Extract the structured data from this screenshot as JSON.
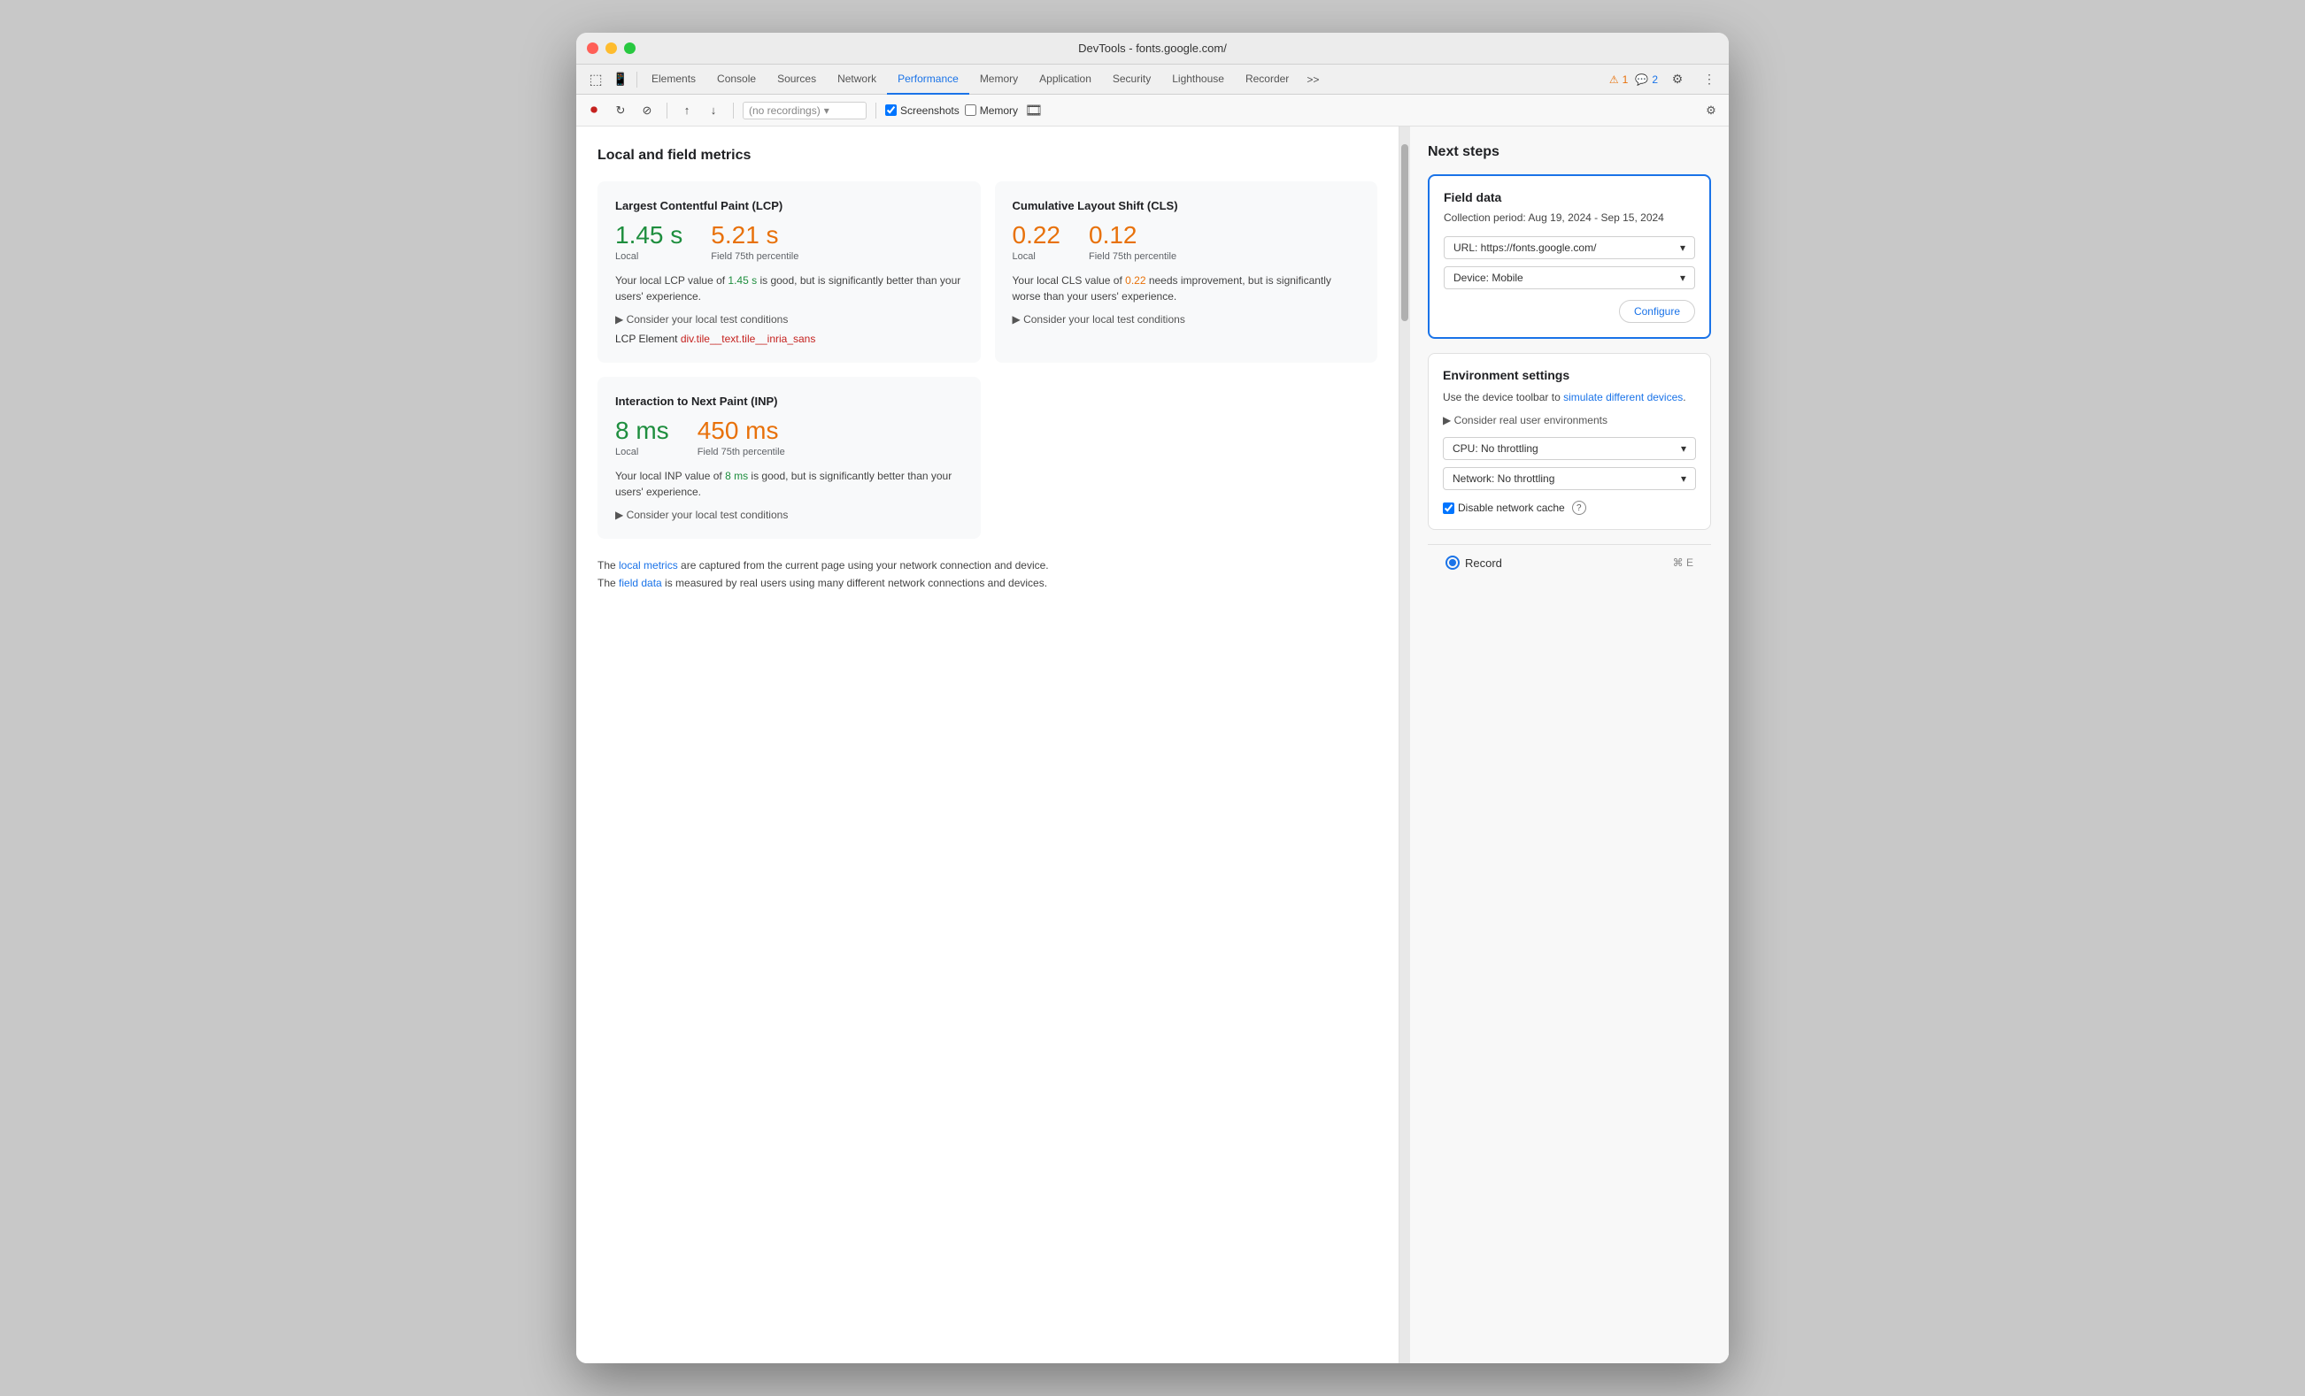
{
  "window": {
    "title": "DevTools - fonts.google.com/"
  },
  "tabs": {
    "items": [
      {
        "label": "Elements",
        "active": false
      },
      {
        "label": "Console",
        "active": false
      },
      {
        "label": "Sources",
        "active": false
      },
      {
        "label": "Network",
        "active": false
      },
      {
        "label": "Performance",
        "active": true
      },
      {
        "label": "Memory",
        "active": false
      },
      {
        "label": "Application",
        "active": false
      },
      {
        "label": "Security",
        "active": false
      },
      {
        "label": "Lighthouse",
        "active": false
      },
      {
        "label": "Recorder",
        "active": false
      }
    ],
    "more": ">>",
    "warnings": "1",
    "messages": "2"
  },
  "secondary_toolbar": {
    "recording_placeholder": "(no recordings)",
    "screenshots_label": "Screenshots",
    "memory_label": "Memory"
  },
  "main": {
    "section_title": "Local and field metrics",
    "lcp_card": {
      "title": "Largest Contentful Paint (LCP)",
      "local_value": "1.45 s",
      "field_value": "5.21 s",
      "local_label": "Local",
      "field_label": "Field 75th percentile",
      "description": "Your local LCP value of ",
      "description_value": "1.45 s",
      "description_end": " is good, but is significantly better than your users' experience.",
      "consider_link": "▶ Consider your local test conditions",
      "lcp_element_label": "LCP Element",
      "lcp_element_value": "div.tile__text.tile__inria_sans"
    },
    "cls_card": {
      "title": "Cumulative Layout Shift (CLS)",
      "local_value": "0.22",
      "field_value": "0.12",
      "local_label": "Local",
      "field_label": "Field 75th percentile",
      "description": "Your local CLS value of ",
      "description_value": "0.22",
      "description_end": " needs improvement, but is significantly worse than your users' experience.",
      "consider_link": "▶ Consider your local test conditions"
    },
    "inp_card": {
      "title": "Interaction to Next Paint (INP)",
      "local_value": "8 ms",
      "field_value": "450 ms",
      "local_label": "Local",
      "field_label": "Field 75th percentile",
      "description": "Your local INP value of ",
      "description_value": "8 ms",
      "description_end": " is good, but is significantly better than your users' experience.",
      "consider_link": "▶ Consider your local test conditions"
    },
    "footer": {
      "line1_start": "The ",
      "line1_link": "local metrics",
      "line1_end": " are captured from the current page using your network connection and device.",
      "line2_start": "The ",
      "line2_link": "field data",
      "line2_end": " is measured by real users using many different network connections and devices."
    }
  },
  "next_steps": {
    "title": "Next steps",
    "field_data": {
      "title": "Field data",
      "period": "Collection period: Aug 19, 2024 - Sep 15, 2024",
      "url_label": "URL: https://fonts.google.com/",
      "device_label": "Device: Mobile",
      "configure_label": "Configure"
    },
    "environment": {
      "title": "Environment settings",
      "description_start": "Use the device toolbar to ",
      "description_link": "simulate different devices",
      "description_end": ".",
      "consider_link": "▶ Consider real user environments",
      "cpu_label": "CPU: No throttling",
      "network_label": "Network: No throttling",
      "disable_cache_label": "Disable network cache",
      "help_icon": "?"
    },
    "record": {
      "label": "Record",
      "shortcut": "⌘ E"
    }
  }
}
